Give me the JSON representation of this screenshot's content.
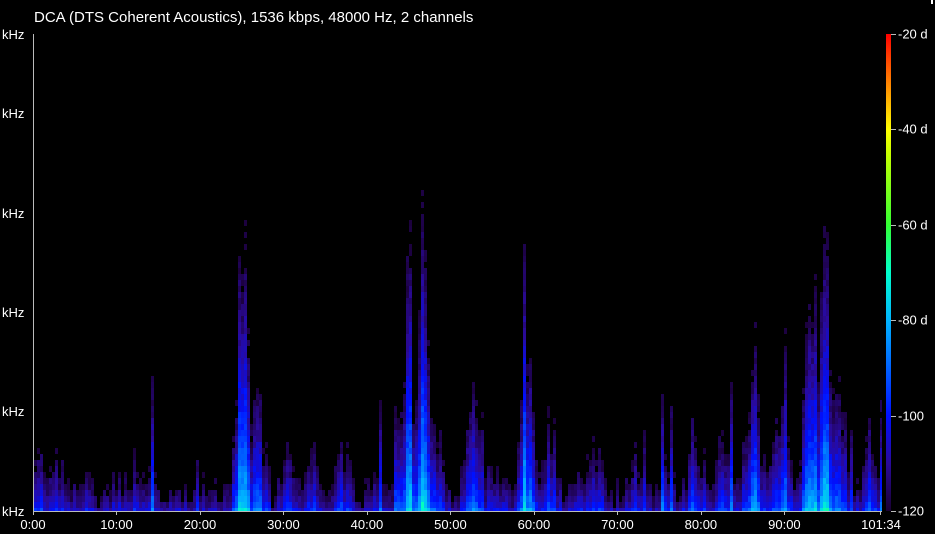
{
  "window": {
    "title": "DCA (DTS Coherent Acoustics), 1536 kbps, 48000 Hz, 2 channels"
  },
  "chart_data": {
    "type": "heatmap",
    "title": "DCA (DTS Coherent Acoustics), 1536 kbps, 48000 Hz, 2 channels",
    "xlabel": "",
    "ylabel": "",
    "x_tick_labels": [
      "0:00",
      "10:00",
      "20:00",
      "30:00",
      "40:00",
      "50:00",
      "60:00",
      "70:00",
      "80:00",
      "90:00",
      "101:34"
    ],
    "x_tick_minutes": [
      0,
      10,
      20,
      30,
      40,
      50,
      60,
      70,
      80,
      90,
      101.57
    ],
    "xlim_minutes": [
      0,
      101.57
    ],
    "y_tick_labels": [
      "kHz",
      "kHz",
      "kHz",
      "kHz",
      "kHz",
      "kHz"
    ],
    "colorbar": {
      "tick_labels": [
        "-20 d",
        "-40 d",
        "-60 d",
        "-80 d",
        "-100",
        "-120"
      ],
      "tick_values": [
        -20,
        -40,
        -60,
        -80,
        -100,
        -120
      ],
      "range": [
        -120,
        -20
      ],
      "stops": [
        {
          "value": -120,
          "color": "#1a0033"
        },
        {
          "value": -110,
          "color": "#2a0a9a"
        },
        {
          "value": -100,
          "color": "#0010ff"
        },
        {
          "value": -80,
          "color": "#00b4ff"
        },
        {
          "value": -70,
          "color": "#00ffcc"
        },
        {
          "value": -60,
          "color": "#33ff33"
        },
        {
          "value": -45,
          "color": "#c8ff00"
        },
        {
          "value": -40,
          "color": "#ffff00"
        },
        {
          "value": -30,
          "color": "#ff8000"
        },
        {
          "value": -20,
          "color": "#ff0000"
        }
      ]
    },
    "activity_profile": [
      {
        "minute": 0.3,
        "intensity": 0.55
      },
      {
        "minute": 2.5,
        "intensity": 0.5
      },
      {
        "minute": 6.0,
        "intensity": 0.45
      },
      {
        "minute": 9.5,
        "intensity": 0.4
      },
      {
        "minute": 12.0,
        "intensity": 0.45
      },
      {
        "minute": 14.0,
        "intensity": 0.5
      },
      {
        "minute": 17.5,
        "intensity": 0.35
      },
      {
        "minute": 21.0,
        "intensity": 0.4
      },
      {
        "minute": 25.0,
        "intensity": 0.85
      },
      {
        "minute": 26.5,
        "intensity": 0.7
      },
      {
        "minute": 30.5,
        "intensity": 0.55
      },
      {
        "minute": 33.5,
        "intensity": 0.5
      },
      {
        "minute": 37.0,
        "intensity": 0.55
      },
      {
        "minute": 41.0,
        "intensity": 0.45
      },
      {
        "minute": 44.5,
        "intensity": 0.8
      },
      {
        "minute": 46.5,
        "intensity": 0.9
      },
      {
        "minute": 48.0,
        "intensity": 0.6
      },
      {
        "minute": 52.5,
        "intensity": 0.75
      },
      {
        "minute": 55.0,
        "intensity": 0.5
      },
      {
        "minute": 59.0,
        "intensity": 0.8
      },
      {
        "minute": 61.5,
        "intensity": 0.6
      },
      {
        "minute": 65.0,
        "intensity": 0.45
      },
      {
        "minute": 67.0,
        "intensity": 0.55
      },
      {
        "minute": 72.0,
        "intensity": 0.5
      },
      {
        "minute": 75.5,
        "intensity": 0.45
      },
      {
        "minute": 79.0,
        "intensity": 0.55
      },
      {
        "minute": 82.5,
        "intensity": 0.6
      },
      {
        "minute": 86.0,
        "intensity": 0.75
      },
      {
        "minute": 89.5,
        "intensity": 0.7
      },
      {
        "minute": 93.0,
        "intensity": 0.9
      },
      {
        "minute": 94.5,
        "intensity": 0.95
      },
      {
        "minute": 96.0,
        "intensity": 0.8
      },
      {
        "minute": 100.0,
        "intensity": 0.6
      }
    ]
  }
}
